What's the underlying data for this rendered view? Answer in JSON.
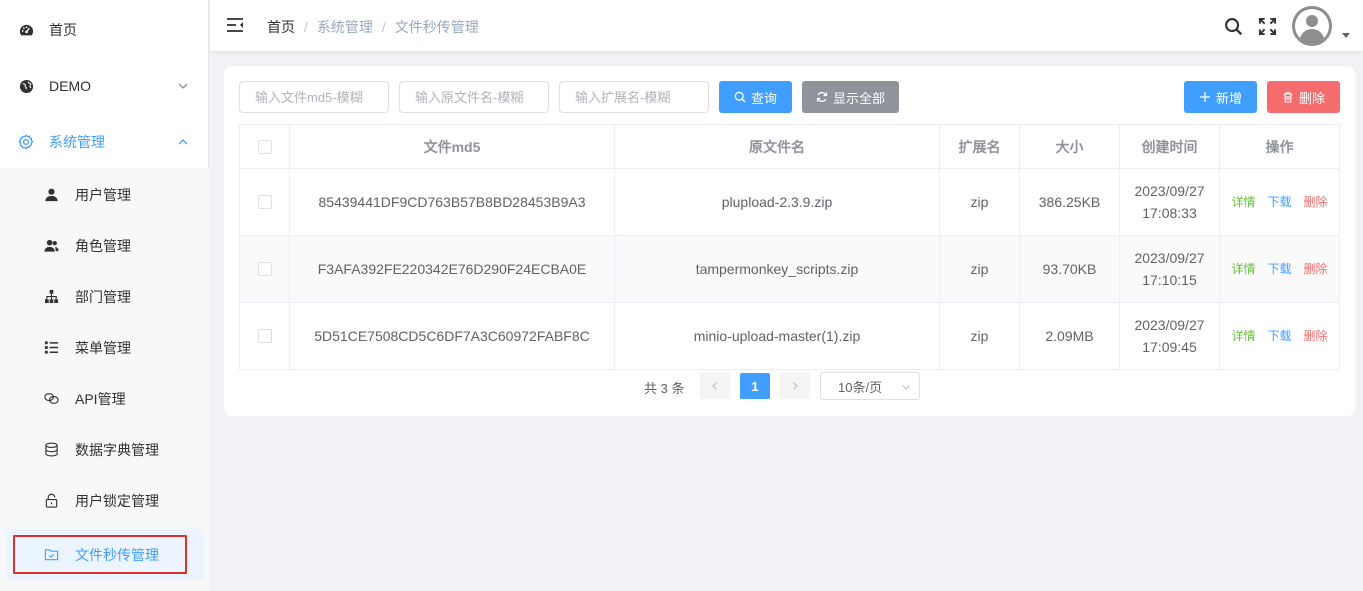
{
  "sidebar": {
    "items": [
      {
        "label": "首页",
        "icon": "dashboard-icon"
      },
      {
        "label": "DEMO",
        "icon": "globe-icon"
      },
      {
        "label": "系统管理",
        "icon": "gear-icon"
      }
    ],
    "submenu": [
      {
        "label": "用户管理",
        "icon": "user-icon"
      },
      {
        "label": "角色管理",
        "icon": "users-icon"
      },
      {
        "label": "部门管理",
        "icon": "org-tree-icon"
      },
      {
        "label": "菜单管理",
        "icon": "list-icon"
      },
      {
        "label": "API管理",
        "icon": "link-icon"
      },
      {
        "label": "数据字典管理",
        "icon": "database-icon"
      },
      {
        "label": "用户锁定管理",
        "icon": "lock-icon"
      },
      {
        "label": "文件秒传管理",
        "icon": "folder-icon"
      }
    ]
  },
  "header": {
    "breadcrumb": [
      "首页",
      "系统管理",
      "文件秒传管理"
    ],
    "separator": "/"
  },
  "toolbar": {
    "md5_placeholder": "输入文件md5-模糊",
    "name_placeholder": "输入原文件名-模糊",
    "ext_placeholder": "输入扩展名-模糊",
    "query_label": "查询",
    "show_all_label": "显示全部",
    "add_label": "新增",
    "delete_label": "删除"
  },
  "table": {
    "columns": [
      "文件md5",
      "原文件名",
      "扩展名",
      "大小",
      "创建时间",
      "操作"
    ],
    "rows": [
      {
        "md5": "85439441DF9CD763B57B8BD28453B9A3",
        "name": "plupload-2.3.9.zip",
        "ext": "zip",
        "size": "386.25KB",
        "date": "2023/09/27",
        "time": "17:08:33"
      },
      {
        "md5": "F3AFA392FE220342E76D290F24ECBA0E",
        "name": "tampermonkey_scripts.zip",
        "ext": "zip",
        "size": "93.70KB",
        "date": "2023/09/27",
        "time": "17:10:15"
      },
      {
        "md5": "5D51CE7508CD5C6DF7A3C60972FABF8C",
        "name": "minio-upload-master(1).zip",
        "ext": "zip",
        "size": "2.09MB",
        "date": "2023/09/27",
        "time": "17:09:45"
      }
    ],
    "ops": {
      "detail": "详情",
      "download": "下载",
      "delete": "删除"
    }
  },
  "pagination": {
    "total_text": "共 3 条",
    "current_page": "1",
    "page_size": "10条/页"
  },
  "colors": {
    "primary": "#409eff",
    "danger": "#f56c6c",
    "success": "#67c23a",
    "info": "#909399"
  }
}
